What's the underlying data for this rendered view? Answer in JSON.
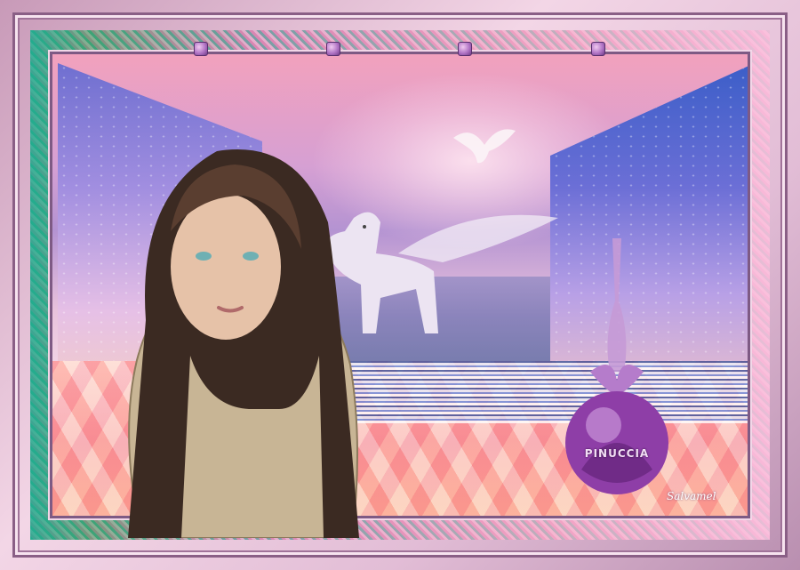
{
  "artwork": {
    "perfume_label": "PINUCCIA",
    "signature_text": "Salvamel"
  },
  "colors": {
    "frame": "#8a5f86",
    "sky_pink": "#f2a1bd",
    "sky_violet": "#b493d2",
    "floor_coral": "#f5a6b8",
    "perfume_purple": "#a04fb5"
  }
}
